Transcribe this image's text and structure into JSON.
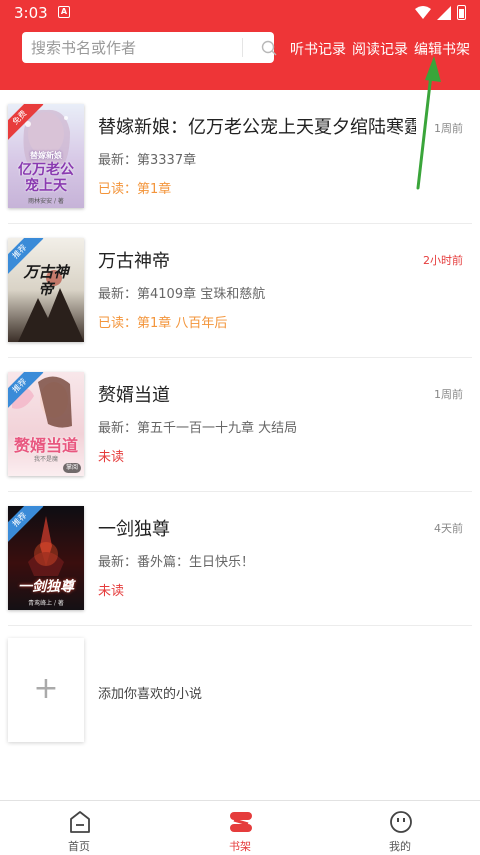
{
  "status_bar": {
    "time": "3:03",
    "notification_badge": "A"
  },
  "search": {
    "placeholder": "搜索书名或作者"
  },
  "header_links": {
    "listen_history": "听书记录",
    "read_history": "阅读记录",
    "edit_shelf": "编辑书架"
  },
  "books": [
    {
      "title": "替嫁新娘：亿万老公宠上天夏夕绾陆寒霆",
      "time": "1周前",
      "latest": "最新：第3337章",
      "progress": "已读：第1章",
      "ribbon": "免费",
      "cover_text": "亿万老公宠上天",
      "cover_subtitle": "替嫁新娘",
      "cover_author": "雨林安安 / 著"
    },
    {
      "title": "万古神帝",
      "time": "2小时前",
      "latest": "最新：第4109章 宝珠和慈航",
      "progress": "已读：第1章 八百年后",
      "ribbon": "推荐",
      "cover_text": "万古神帝"
    },
    {
      "title": "赘婿当道",
      "time": "1周前",
      "latest": "最新：第五千一百一十九章 大结局",
      "progress": "未读",
      "ribbon": "推荐",
      "cover_text": "赘婿当道",
      "cover_author": "我不是魔",
      "cover_badge": "掌阅"
    },
    {
      "title": "一剑独尊",
      "time": "4天前",
      "latest": "最新：番外篇：生日快乐！",
      "progress": "未读",
      "ribbon": "推荐",
      "cover_text": "一剑独尊",
      "cover_author": "青鸾峰上 / 著"
    }
  ],
  "add_book": {
    "plus": "+",
    "label": "添加你喜欢的小说"
  },
  "bottom_nav": {
    "home": "首页",
    "shelf": "书架",
    "mine": "我的"
  },
  "colors": {
    "brand_red": "#ee3537",
    "progress_orange": "#f3953b",
    "alert_red": "#e53c3c",
    "annotation_green": "#3aa53a"
  }
}
